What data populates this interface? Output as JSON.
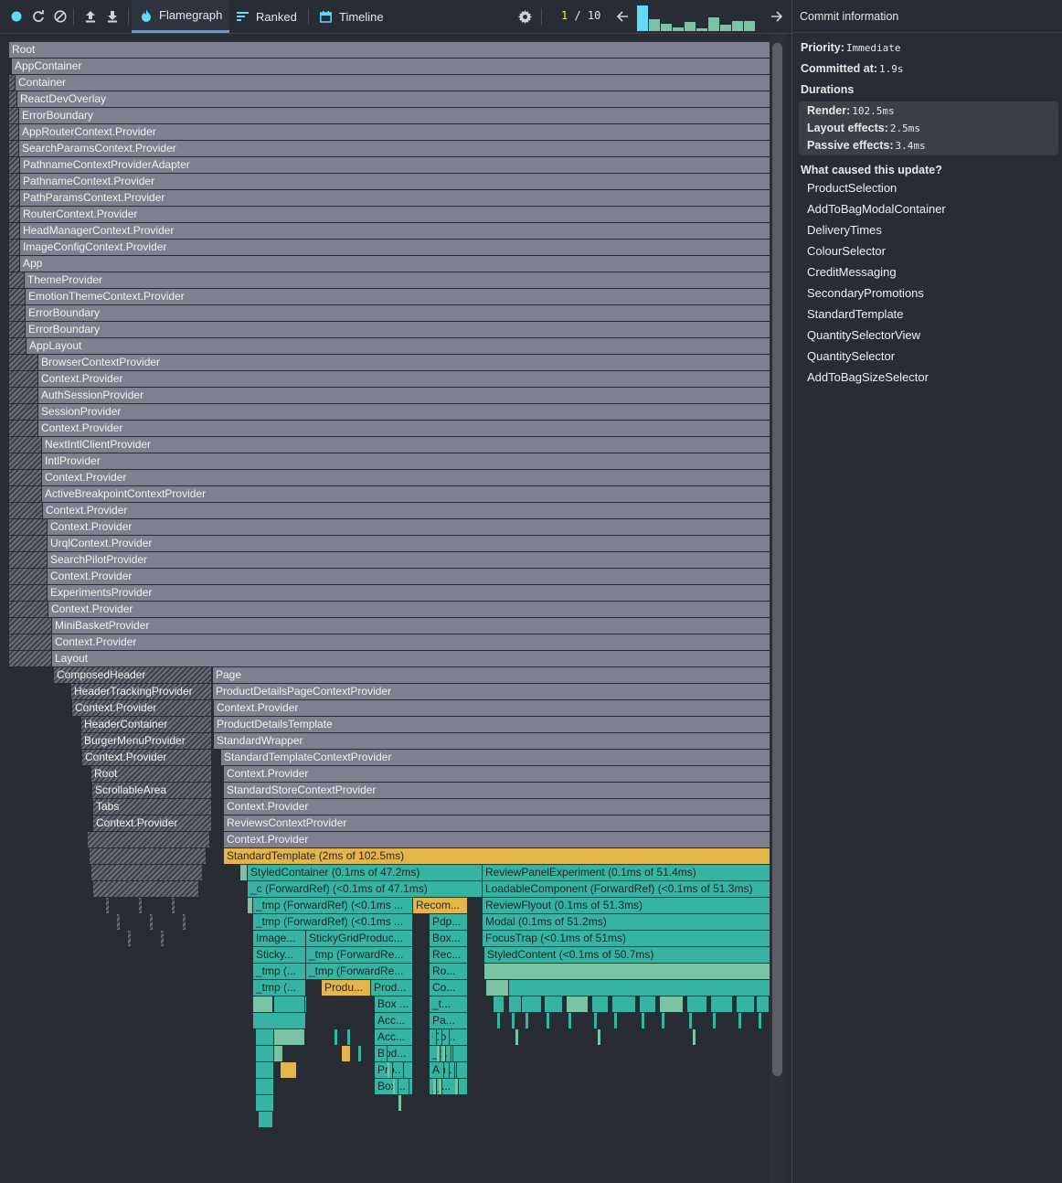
{
  "toolbar": {
    "tabs": [
      {
        "label": "Flamegraph",
        "icon": "flame-icon",
        "active": true
      },
      {
        "label": "Ranked",
        "icon": "ranked-icon",
        "active": false
      },
      {
        "label": "Timeline",
        "icon": "calendar-icon",
        "active": false
      }
    ],
    "commit_index": "1",
    "commit_total": "/ 10",
    "commit_durations": [
      1.0,
      0.45,
      0.3,
      0.15,
      0.35,
      0.1,
      0.55,
      0.25,
      0.4,
      0.4
    ],
    "accent": "#61dafb"
  },
  "sidebar": {
    "title": "Commit information",
    "priority_label": "Priority",
    "priority_value": "Immediate",
    "committed_label": "Committed at",
    "committed_value": "1.9s",
    "durations_label": "Durations",
    "render_label": "Render",
    "render_value": "102.5ms",
    "layout_label": "Layout effects",
    "layout_value": "2.5ms",
    "passive_label": "Passive effects",
    "passive_value": "3.4ms",
    "causes_label": "What caused this update?",
    "causes": [
      "ProductSelection",
      "AddToBagModalContainer",
      "DeliveryTimes",
      "ColourSelector",
      "CreditMessaging",
      "SecondaryPromotions",
      "StandardTemplate",
      "QuantitySelectorView",
      "QuantitySelector",
      "AddToBagSizeSelector"
    ]
  },
  "flamegraph": {
    "colors": {
      "not_rendered": "#7d808f",
      "rendered_fast": "#37b3a3",
      "rendered_mid": "#7ac4a5",
      "rendered_slow": "#e3b54a"
    },
    "rows": [
      [
        "Root",
        "AppContainer",
        "Container",
        "ReactDevOverlay",
        "ErrorBoundary",
        "AppRouterContext.Provider",
        "SearchParamsContext.Provider",
        "PathnameContextProviderAdapter",
        "PathnameContext.Provider",
        "PathParamsContext.Provider",
        "RouterContext.Provider",
        "HeadManagerContext.Provider",
        "ImageConfigContext.Provider",
        "App",
        "ThemeProvider",
        "EmotionThemeContext.Provider",
        "ErrorBoundary",
        "ErrorBoundary",
        "AppLayout",
        "BrowserContextProvider",
        "Context.Provider",
        "AuthSessionProvider",
        "SessionProvider",
        "Context.Provider",
        "NextIntlClientProvider",
        "IntlProvider",
        "Context.Provider",
        "ActiveBreakpointContextProvider",
        "Context.Provider",
        "Context.Provider",
        "UrqlContext.Provider",
        "SearchPilotProvider",
        "Context.Provider",
        "ExperimentsProvider",
        "Context.Provider",
        "MiniBasketProvider",
        "Context.Provider",
        "Layout"
      ]
    ],
    "header_branch": [
      "ComposedHeader",
      "HeaderTrackingProvider",
      "Context.Provider",
      "HeaderContainer",
      "BurgerMenuProvider",
      "Context.Provider",
      "Root",
      "ScrollableArea",
      "Tabs",
      "Context.Provider"
    ],
    "page_branch": [
      "Page",
      "ProductDetailsPageContextProvider",
      "Context.Provider",
      "ProductDetailsTemplate",
      "StandardWrapper",
      "StandardTemplateContextProvider",
      "Context.Provider",
      "StandardStoreContextProvider",
      "Context.Provider",
      "ReviewsContextProvider",
      "Context.Provider"
    ],
    "standard_template": "StandardTemplate (2ms of 102.5ms)",
    "left_column": [
      "StyledContainer (0.1ms of 47.2ms)",
      "_c (ForwardRef) (<0.1ms of 47.1ms)",
      "_tmp (ForwardRef) (<0.1ms ...",
      "_tmp (ForwardRef) (<0.1ms ..."
    ],
    "right_column": [
      "ReviewPanelExperiment (0.1ms of 51.4ms)",
      "LoadableComponent (ForwardRef) (<0.1ms of 51.3ms)",
      "ReviewFlyout (0.1ms of 51.3ms)",
      "Modal (0.1ms of 51.2ms)",
      "FocusTrap (<0.1ms of 51ms)",
      "StyledContent (<0.1ms of 50.7ms)"
    ],
    "recom": "Recom...",
    "mid_column": [
      "Pdp...",
      "Box...",
      "Rec...",
      "Ro...",
      "Co...",
      "_t...",
      "Pa...",
      "Co...",
      "_t...",
      "An...",
      "_t..."
    ],
    "left_sub_a": [
      "Image...",
      "Sticky...",
      "_tmp (...",
      "_tmp (..."
    ],
    "left_sub_b": [
      "StickyGridProduc...",
      "_tmp (ForwardRe...",
      "_tmp (ForwardRe..."
    ],
    "produ": "Produ...",
    "prod": "Prod...",
    "box_column": [
      "Box ...",
      "Acc...",
      "Acc...",
      "Bod...",
      "Pro...",
      "Box..."
    ]
  }
}
